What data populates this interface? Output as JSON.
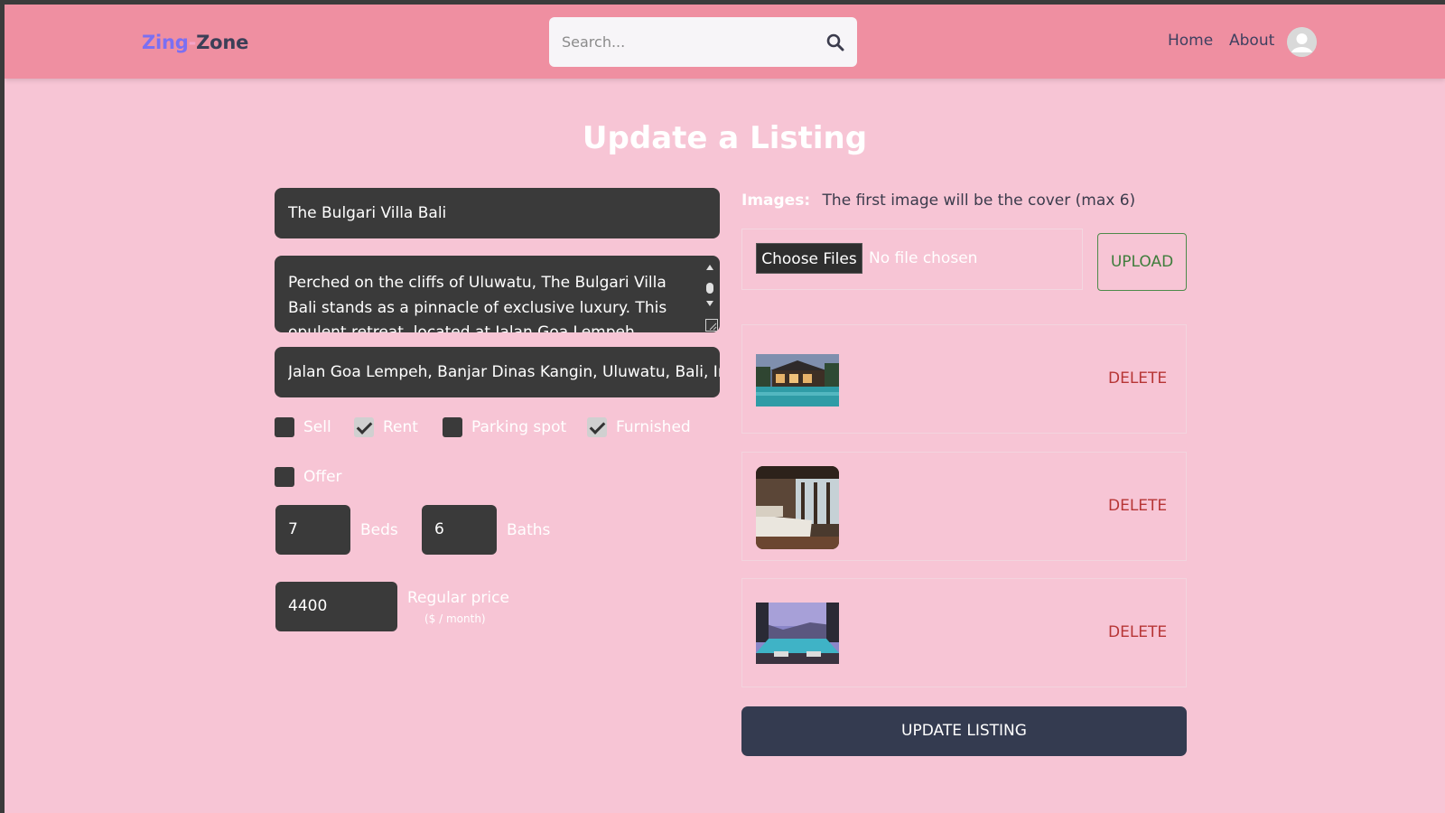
{
  "header": {
    "logo": {
      "part1": "Zing",
      "sep": "-",
      "part2": "Zone"
    },
    "search": {
      "placeholder": "Search...",
      "icon": "search-icon"
    },
    "nav": {
      "home": "Home",
      "about": "About"
    },
    "avatar_icon": "user-avatar-icon"
  },
  "form": {
    "title": "Update a Listing",
    "name_value": "The Bulgari Villa Bali",
    "description_value": "Perched on the cliffs of Uluwatu, The Bulgari Villa Bali stands as a pinnacle of exclusive luxury. This opulent retreat, located at Jalan Goa Lempeh, Banjar Dinas",
    "address_value": "Jalan Goa Lempeh, Banjar Dinas Kangin, Uluwatu, Bali, Inc",
    "options": [
      {
        "label": "Sell",
        "checked": false
      },
      {
        "label": "Rent",
        "checked": true
      },
      {
        "label": "Parking spot",
        "checked": false
      },
      {
        "label": "Furnished",
        "checked": true
      },
      {
        "label": "Offer",
        "checked": false
      }
    ],
    "beds": {
      "value": "7",
      "label": "Beds"
    },
    "baths": {
      "value": "6",
      "label": "Baths"
    },
    "price": {
      "value": "4400",
      "label": "Regular price",
      "unit": "($ / month)"
    }
  },
  "images": {
    "label": "Images:",
    "hint": "The first image will be the cover (max 6)",
    "choose_files": "Choose Files",
    "no_file": "No file chosen",
    "upload": "UPLOAD",
    "items": [
      {
        "alt": "villa-pool-evening",
        "delete": "DELETE"
      },
      {
        "alt": "villa-bedroom",
        "delete": "DELETE"
      },
      {
        "alt": "villa-pool-sunset",
        "delete": "DELETE"
      }
    ]
  },
  "submit": {
    "label": "UPDATE LISTING"
  },
  "colors": {
    "header_bg": "#ef8fa1",
    "page_bg": "#f7c5d5",
    "input_bg": "#3a3a3a",
    "primary_button": "#343b50",
    "delete": "#b73535",
    "upload": "#3f7d3c"
  }
}
